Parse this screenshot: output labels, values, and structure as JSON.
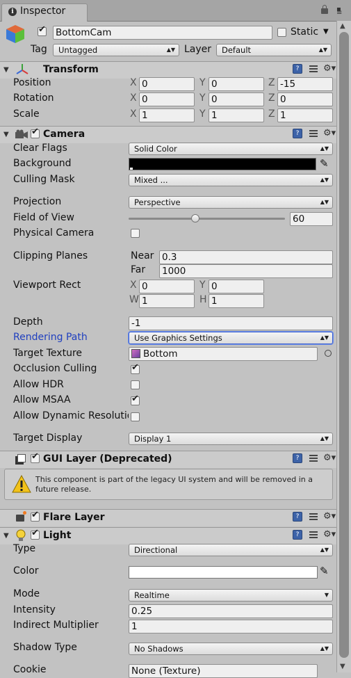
{
  "window": {
    "tab_title": "Inspector"
  },
  "object": {
    "name": "BottomCam",
    "static_label": "Static",
    "tag_label": "Tag",
    "tag_value": "Untagged",
    "layer_label": "Layer",
    "layer_value": "Default"
  },
  "transform": {
    "title": "Transform",
    "position_label": "Position",
    "rotation_label": "Rotation",
    "scale_label": "Scale",
    "position": {
      "x": "0",
      "y": "0",
      "z": "-15"
    },
    "rotation": {
      "x": "0",
      "y": "0",
      "z": "0"
    },
    "scale": {
      "x": "1",
      "y": "1",
      "z": "1"
    }
  },
  "axes": {
    "x": "X",
    "y": "Y",
    "z": "Z",
    "w": "W",
    "h": "H"
  },
  "camera": {
    "title": "Camera",
    "clear_flags_label": "Clear Flags",
    "clear_flags": "Solid Color",
    "background_label": "Background",
    "background_color": "#000000",
    "culling_mask_label": "Culling Mask",
    "culling_mask": "Mixed ...",
    "projection_label": "Projection",
    "projection": "Perspective",
    "fov_label": "Field of View",
    "fov": "60",
    "fov_slider_fraction": 0.428,
    "physical_label": "Physical Camera",
    "clipping_label": "Clipping Planes",
    "near_label": "Near",
    "near": "0.3",
    "far_label": "Far",
    "far": "1000",
    "viewport_label": "Viewport Rect",
    "vp_x": "0",
    "vp_y": "0",
    "vp_w": "1",
    "vp_h": "1",
    "depth_label": "Depth",
    "depth": "-1",
    "rendering_path_label": "Rendering Path",
    "rendering_path": "Use Graphics Settings",
    "target_texture_label": "Target Texture",
    "target_texture": "Bottom",
    "occlusion_label": "Occlusion Culling",
    "hdr_label": "Allow HDR",
    "msaa_label": "Allow MSAA",
    "dynres_label": "Allow Dynamic Resolutio",
    "target_display_label": "Target Display",
    "target_display": "Display 1"
  },
  "gui_layer": {
    "title": "GUI Layer (Deprecated)",
    "warning": "This component is part of the legacy UI system and will be removed in a future release."
  },
  "flare_layer": {
    "title": "Flare Layer"
  },
  "light": {
    "title": "Light",
    "type_label": "Type",
    "type": "Directional",
    "color_label": "Color",
    "color": "#ffffff",
    "mode_label": "Mode",
    "mode": "Realtime",
    "intensity_label": "Intensity",
    "intensity": "0.25",
    "indirect_label": "Indirect Multiplier",
    "indirect": "1",
    "shadow_label": "Shadow Type",
    "shadow": "No Shadows",
    "cookie_label": "Cookie",
    "cookie": "None (Texture)"
  },
  "colors": {
    "link_blue": "#1f3fbf",
    "header_bg": "#cbcbcb",
    "panel_bg": "#c2c2c2"
  }
}
